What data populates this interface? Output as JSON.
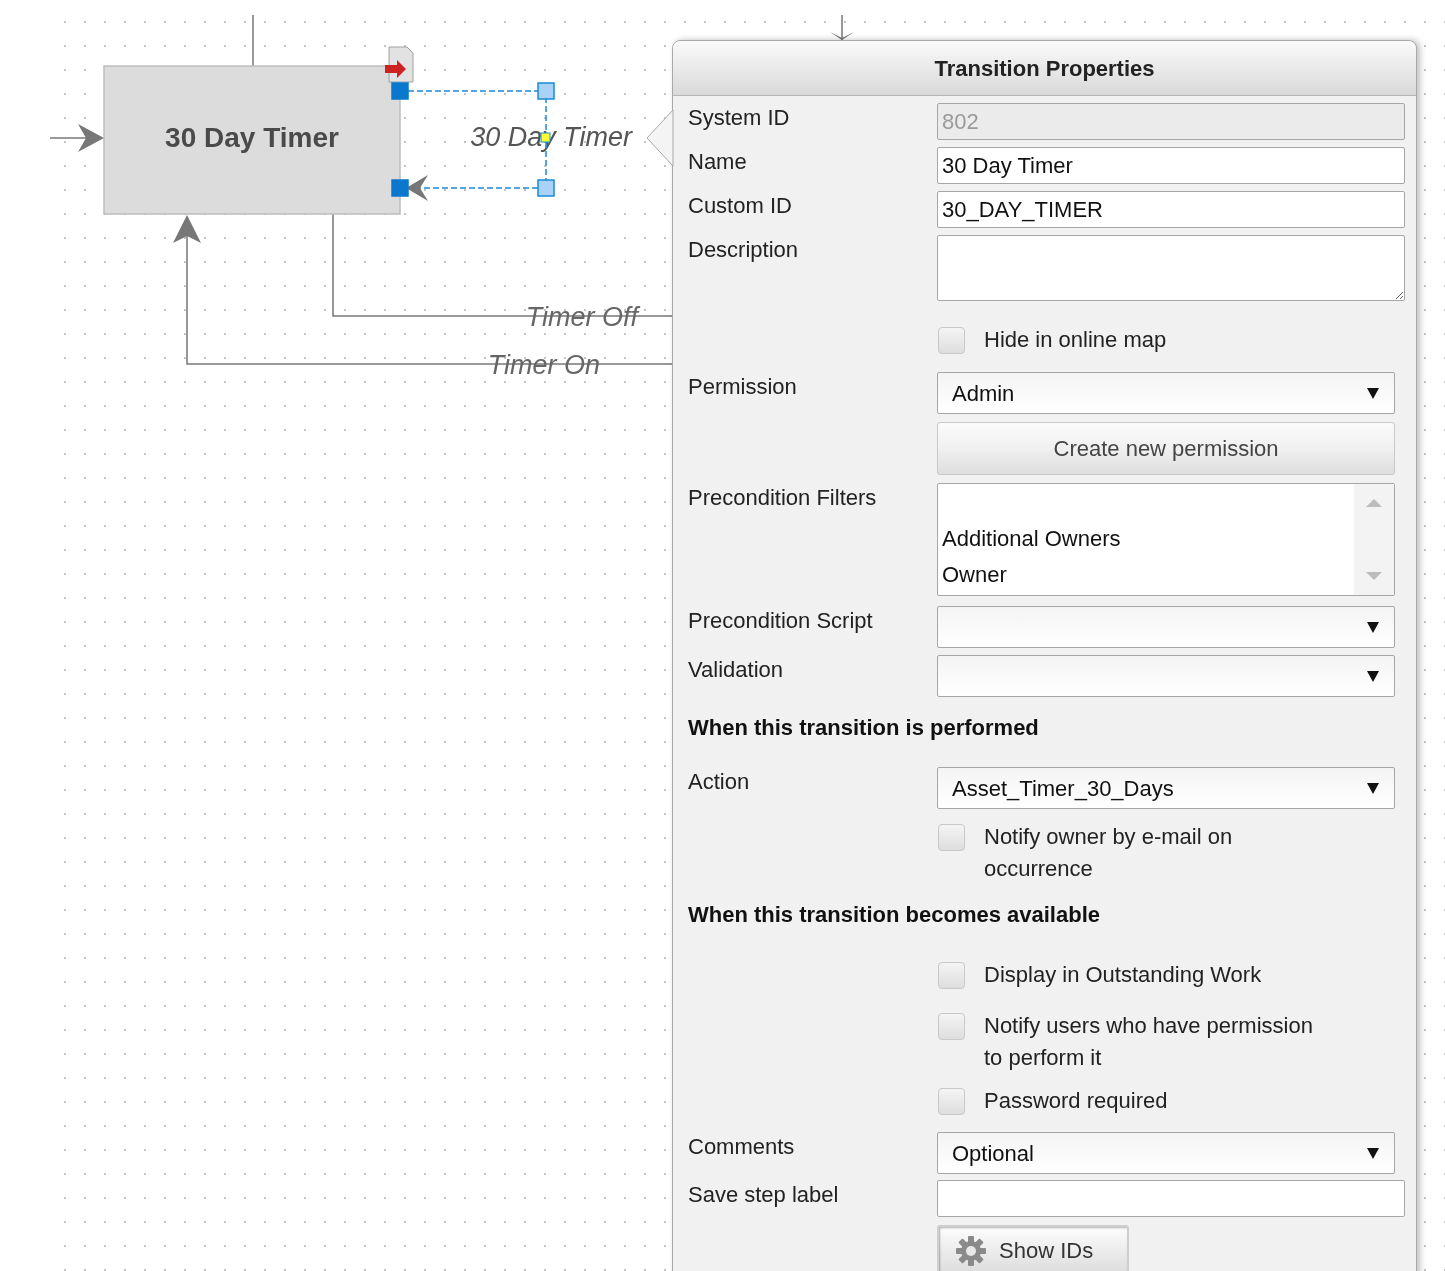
{
  "diagram": {
    "states": [
      {
        "label": "30 Day Timer"
      }
    ],
    "selected_transition": {
      "label": "30 Day Timer",
      "selected": true
    },
    "transitions": [
      {
        "label": "Timer Off"
      },
      {
        "label": "Timer On"
      }
    ]
  },
  "panel": {
    "title": "Transition Properties",
    "rows": [
      {
        "kind": "text",
        "label": "System ID",
        "value": "802",
        "disabled": true
      },
      {
        "kind": "text",
        "label": "Name",
        "value": "30 Day Timer",
        "disabled": false
      },
      {
        "kind": "text",
        "label": "Custom ID",
        "value": "30_DAY_TIMER",
        "disabled": false
      },
      {
        "kind": "textarea",
        "label": "Description",
        "disabled": false
      },
      {
        "kind": "checkbox",
        "text": "Hide in online map",
        "checked": false
      },
      {
        "kind": "select",
        "label": "Permission",
        "value": "Admin"
      },
      {
        "kind": "button",
        "text": "Create new permission"
      },
      {
        "kind": "listbox",
        "label": "Precondition Filters",
        "options": [
          {
            "label": "Additional Owners",
            "selected": false
          },
          {
            "label": "Owner",
            "selected": false
          }
        ]
      },
      {
        "kind": "select",
        "label": "Precondition Script"
      },
      {
        "kind": "select",
        "label": "Validation"
      },
      {
        "kind": "heading",
        "text": "When this transition is performed"
      },
      {
        "kind": "select",
        "label": "Action",
        "value": "Asset_Timer_30_Days"
      },
      {
        "kind": "checkbox",
        "text": "Notify owner by e-mail on occurrence",
        "checked": false
      },
      {
        "kind": "heading",
        "text": "When this transition becomes available"
      },
      {
        "kind": "checkbox",
        "text": "Display in Outstanding Work",
        "checked": false
      },
      {
        "kind": "checkbox",
        "text": "Notify users who have permission to perform it",
        "checked": false
      },
      {
        "kind": "checkbox",
        "text": "Password required",
        "checked": false
      },
      {
        "kind": "select",
        "label": "Comments",
        "value": "Optional"
      },
      {
        "kind": "text",
        "label": "Save step label",
        "disabled": false
      },
      {
        "kind": "gear-button",
        "text": "Show IDs"
      }
    ]
  }
}
